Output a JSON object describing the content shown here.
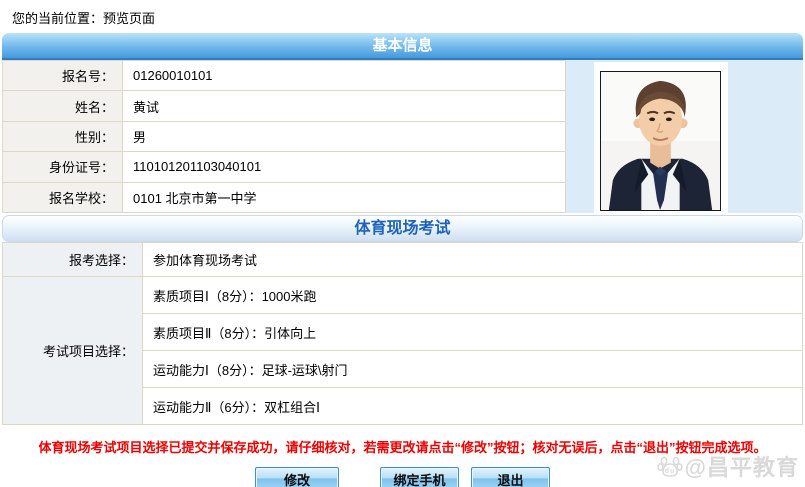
{
  "breadcrumb": "您的当前位置：预览页面",
  "section_basic": {
    "title": "基本信息",
    "rows": [
      {
        "label": "报名号：",
        "value": "01260010101"
      },
      {
        "label": "姓名：",
        "value": "黄试"
      },
      {
        "label": "性别：",
        "value": "男"
      },
      {
        "label": "身份证号：",
        "value": "110101201103040101"
      },
      {
        "label": "报名学校：",
        "value": "0101 北京市第一中学"
      }
    ]
  },
  "section_exam": {
    "title": "体育现场考试",
    "choice_label": "报考选择：",
    "choice_value": "参加体育现场考试",
    "items_label": "考试项目选择：",
    "items": [
      "素质项目Ⅰ（8分）：1000米跑",
      "素质项目Ⅱ（8分）：引体向上",
      "运动能力Ⅰ（8分）：足球-运球\\射门",
      "运动能力Ⅱ（6分）：双杠组合Ⅰ"
    ]
  },
  "notice": "体育现场考试项目选择已提交并保存成功，请仔细核对，若需更改请点击“修改”按钮；核对无误后，点击“退出”按钮完成选项。",
  "buttons": {
    "modify": "修改",
    "bind_phone": "绑定手机",
    "exit": "退出"
  },
  "watermark": "@昌平教育",
  "colors": {
    "header_blue": "#4599dd",
    "header2_text_blue": "#1e63b8",
    "notice_red": "#ee0000",
    "photo_cell_blue": "#dcebf8",
    "table_border_tan": "#ded7c6",
    "button_blue": "#7fc2ee"
  }
}
